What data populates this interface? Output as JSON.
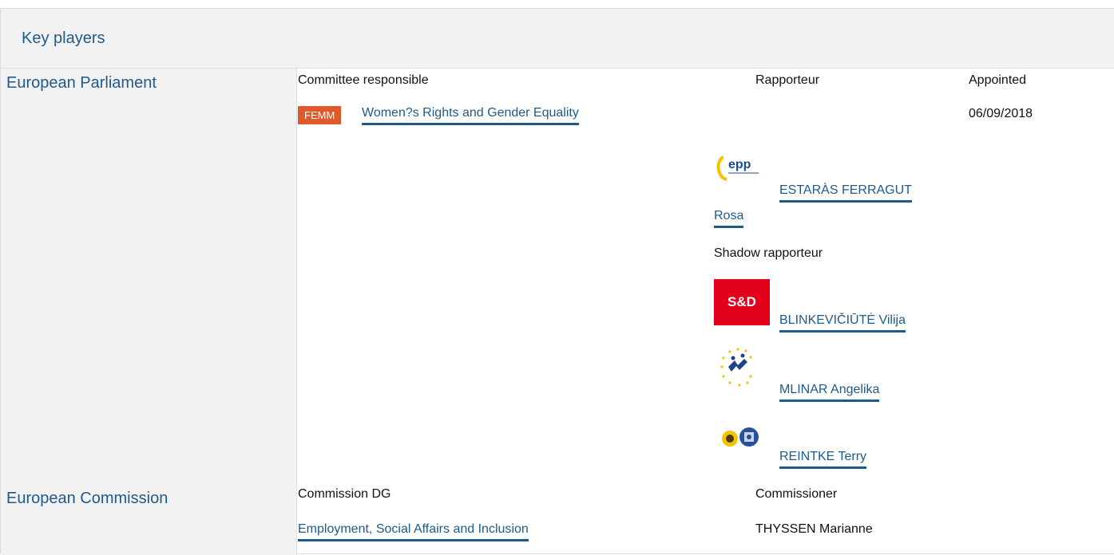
{
  "header": {
    "title": "Key players"
  },
  "parliament": {
    "label": "European Parliament",
    "committee_header": "Committee responsible",
    "rapporteur_header": "Rapporteur",
    "appointed_header": "Appointed",
    "committee_badge": "FEMM",
    "committee_name": "Women?s Rights and Gender Equality",
    "appointed_date": "06/09/2018",
    "rapporteur": {
      "group_logo": "epp-logo",
      "name_line1": "ESTARÀS FERRAGUT",
      "name_line2": "Rosa"
    },
    "shadow_header": "Shadow rapporteur",
    "shadows": [
      {
        "group_logo": "s-and-d-logo",
        "logo_text": "S&D",
        "name": "BLINKEVIČIŪTĖ Vilija"
      },
      {
        "group_logo": "alde-logo",
        "name": "MLINAR Angelika"
      },
      {
        "group_logo": "greens-efa-logo",
        "name": "REINTKE Terry"
      }
    ]
  },
  "commission": {
    "label": "European Commission",
    "dg_header": "Commission DG",
    "commissioner_header": "Commissioner",
    "dg_name": "Employment, Social Affairs and Inclusion",
    "commissioner_name": "THYSSEN Marianne"
  }
}
